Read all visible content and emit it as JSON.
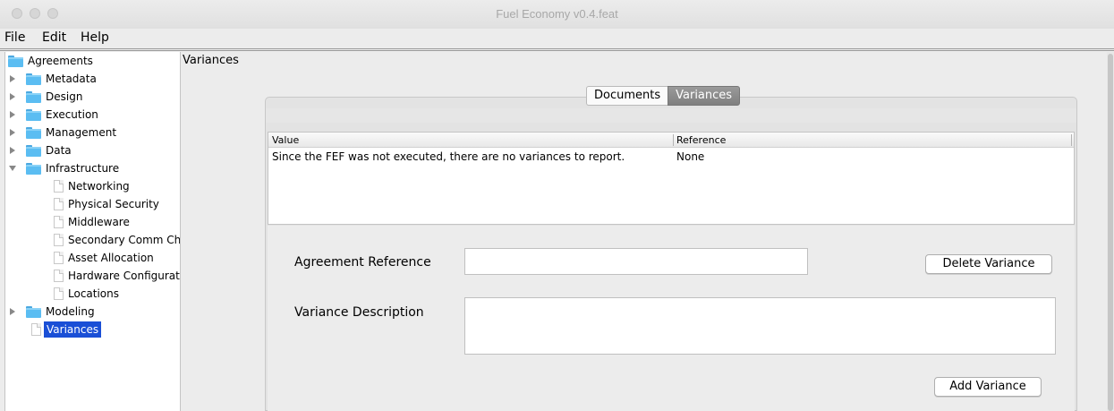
{
  "window": {
    "title": "Fuel Economy v0.4.feat"
  },
  "menu": {
    "items": [
      "File",
      "Edit",
      "Help"
    ]
  },
  "sidebar": {
    "root": "Agreements",
    "items": [
      {
        "label": "Metadata",
        "type": "folder",
        "expanded": false
      },
      {
        "label": "Design",
        "type": "folder",
        "expanded": false
      },
      {
        "label": "Execution",
        "type": "folder",
        "expanded": false
      },
      {
        "label": "Management",
        "type": "folder",
        "expanded": false
      },
      {
        "label": "Data",
        "type": "folder",
        "expanded": false
      },
      {
        "label": "Infrastructure",
        "type": "folder",
        "expanded": true
      },
      {
        "label": "Networking",
        "type": "file"
      },
      {
        "label": "Physical Security",
        "type": "file"
      },
      {
        "label": "Middleware",
        "type": "file"
      },
      {
        "label": "Secondary Comm Ch",
        "type": "file"
      },
      {
        "label": "Asset Allocation",
        "type": "file"
      },
      {
        "label": "Hardware Configurat",
        "type": "file"
      },
      {
        "label": "Locations",
        "type": "file"
      },
      {
        "label": "Modeling",
        "type": "folder",
        "expanded": false
      },
      {
        "label": "Variances",
        "type": "file",
        "selected": true
      }
    ]
  },
  "main": {
    "header": "Variances",
    "tabs": [
      {
        "label": "Documents",
        "active": false
      },
      {
        "label": "Variances",
        "active": true
      }
    ],
    "table": {
      "columns": [
        "Value",
        "Reference"
      ],
      "rows": [
        [
          "Since the FEF was not executed, there are no variances to report.",
          "None"
        ]
      ]
    },
    "form": {
      "agreement_reference_label": "Agreement Reference",
      "agreement_reference_value": "",
      "variance_description_label": "Variance Description",
      "variance_description_value": "",
      "delete_button": "Delete Variance",
      "add_button": "Add Variance"
    }
  },
  "colors": {
    "selection": "#1a4fd6",
    "folder": "#5bbdf2",
    "active_tab": "#8a8a8a"
  }
}
